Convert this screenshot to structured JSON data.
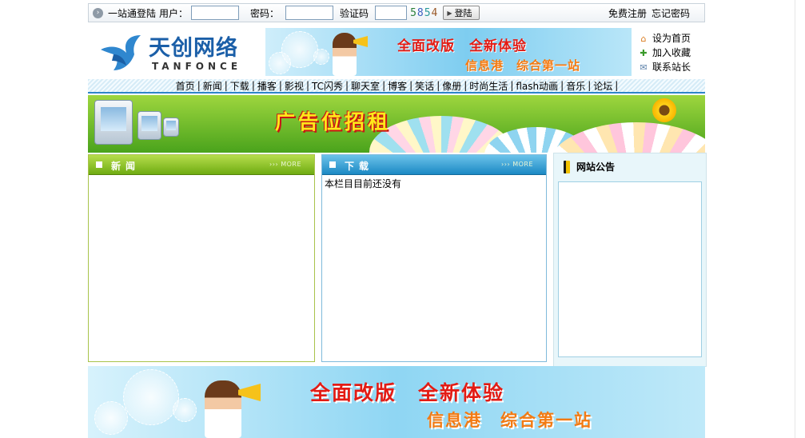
{
  "login": {
    "intro": "一站通登陆",
    "user_label": "用户：",
    "password_label": "密码：",
    "captcha_label": "验证码",
    "captcha_digits": [
      "5",
      "8",
      "5",
      "4"
    ],
    "submit_label": "登陆",
    "register_link": "免费注册",
    "forgot_link": "忘记密码"
  },
  "header": {
    "logo_cn": "天创网络",
    "logo_en": "TANFONCE",
    "banner_line1": "全面改版　全新体验",
    "banner_line2": "信息港　综合第一站",
    "quick_links": [
      {
        "label": "设为首页",
        "icon": "home-icon"
      },
      {
        "label": "加入收藏",
        "icon": "favorite-icon"
      },
      {
        "label": "联系站长",
        "icon": "mail-icon"
      }
    ]
  },
  "nav": {
    "items": [
      "首页",
      "新闻",
      "下载",
      "播客",
      "影视",
      "TC闪秀",
      "聊天室",
      "博客",
      "笑话",
      "像册",
      "时尚生活",
      "flash动画",
      "音乐",
      "论坛"
    ],
    "separator": "|"
  },
  "ad": {
    "text": "广告位招租"
  },
  "news": {
    "title": "新闻",
    "more": "››› MORE"
  },
  "download": {
    "title": "下载",
    "more": "››› MORE",
    "empty_text": "本栏目目前还没有"
  },
  "notice": {
    "title": "网站公告"
  },
  "bottom_banner": {
    "line1": "全面改版　全新体验",
    "line2": "信息港　综合第一站"
  },
  "colors": {
    "nav_underline": "#2e86c8",
    "news_header": "#6fac12",
    "download_header": "#1b89c4",
    "banner_red": "#e31b14",
    "banner_orange": "#f37a12"
  }
}
